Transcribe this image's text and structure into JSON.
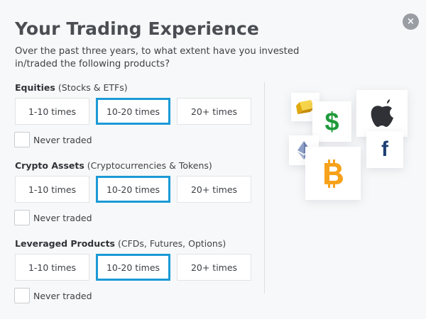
{
  "header": {
    "title": "Your Trading Experience",
    "subtitle": "Over the past three years, to what extent have you invested in/traded the following products?",
    "close_label": "×"
  },
  "sections": [
    {
      "label_bold": "Equities",
      "label_rest": " (Stocks & ETFs)",
      "options": [
        "1-10 times",
        "10-20 times",
        "20+ times"
      ],
      "selected": "10-20 times",
      "never_label": "Never traded",
      "never_checked": false
    },
    {
      "label_bold": "Crypto Assets",
      "label_rest": " (Cryptocurrencies & Tokens)",
      "options": [
        "1-10 times",
        "10-20 times",
        "20+ times"
      ],
      "selected": "10-20 times",
      "never_label": "Never traded",
      "never_checked": false
    },
    {
      "label_bold": "Leveraged Products",
      "label_rest": " (CFDs, Futures, Options)",
      "options": [
        "1-10 times",
        "10-20 times",
        "20+ times"
      ],
      "selected": "10-20 times",
      "never_label": "Never traded",
      "never_checked": false
    }
  ],
  "illustration": {
    "icons": [
      "gold-bar-icon",
      "dollar-sign-icon",
      "apple-logo-icon",
      "ethereum-icon",
      "facebook-logo-icon",
      "bitcoin-icon"
    ],
    "dollar_glyph": "$",
    "facebook_glyph": "f",
    "dollar_color": "#1f9a3a",
    "bitcoin_color": "#f7a21b",
    "facebook_color": "#1d3f73",
    "apple_color": "#2f3136",
    "gold_color": "#f2c21a"
  },
  "colors": {
    "accent": "#1a9ad6",
    "background": "#f7f8f9"
  }
}
